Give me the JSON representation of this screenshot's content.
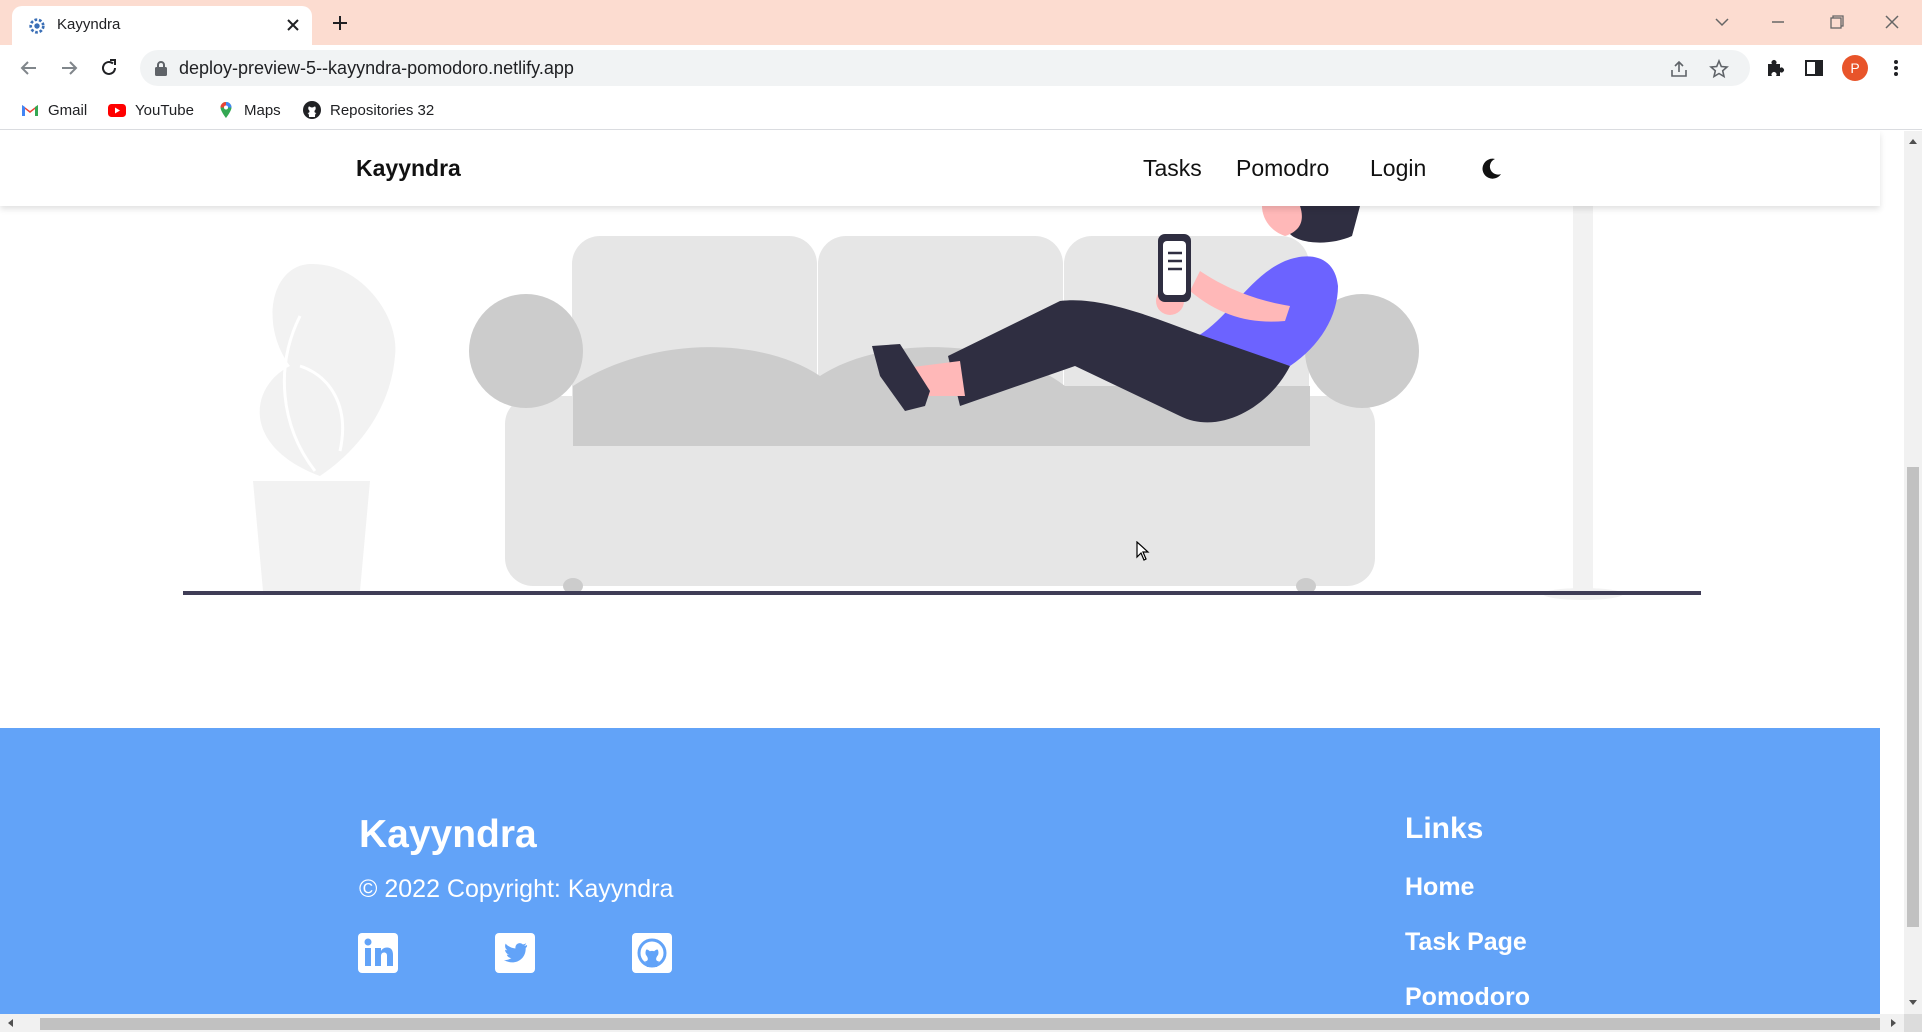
{
  "browser": {
    "tab": {
      "title": "Kayyndra",
      "favicon": "gear-favicon"
    },
    "new_tab_icon": "plus-icon",
    "window_controls": [
      "tab-search-icon",
      "minimize-icon",
      "restore-icon",
      "close-icon"
    ],
    "url": "deploy-preview-5--kayyndra-pomodoro.netlify.app",
    "profile_initial": "P",
    "bookmarks": [
      {
        "label": "Gmail",
        "icon": "gmail-icon"
      },
      {
        "label": "YouTube",
        "icon": "youtube-icon"
      },
      {
        "label": "Maps",
        "icon": "maps-icon"
      },
      {
        "label": "Repositories 32",
        "icon": "github-icon"
      }
    ]
  },
  "site": {
    "brand": "Kayyndra",
    "nav": {
      "tasks": "Tasks",
      "pomodoro": "Pomodro",
      "login": "Login",
      "theme_icon": "moon-icon"
    },
    "illustration": "person-relaxing-on-couch-illustration"
  },
  "footer": {
    "brand": "Kayyndra",
    "copyright": "© 2022 Copyright: Kayyndra",
    "social": [
      "linkedin-icon",
      "twitter-icon",
      "github-icon"
    ],
    "links_title": "Links",
    "links": {
      "home": "Home",
      "task_page": "Task Page",
      "pomodoro": "Pomodoro"
    }
  },
  "colors": {
    "tabstrip": "#fcdcd0",
    "footer": "#62a3f8",
    "accent_shirt": "#6c63ff",
    "dark": "#2f2e41"
  }
}
